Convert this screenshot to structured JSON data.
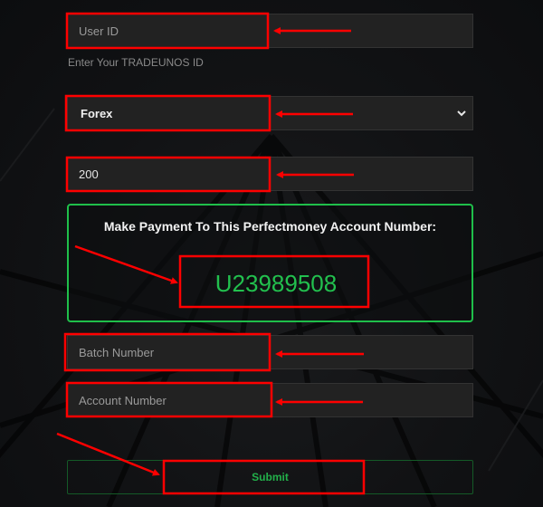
{
  "form": {
    "user_id": {
      "placeholder": "User ID",
      "help": "Enter Your TRADEUNOS ID"
    },
    "market_select": {
      "selected": "Forex",
      "icon": "chevron-down-icon"
    },
    "amount": {
      "value": "200"
    },
    "payment_panel": {
      "title": "Make Payment To This Perfectmoney Account Number:",
      "account_number": "U23989508"
    },
    "batch_number": {
      "placeholder": "Batch Number"
    },
    "account_number": {
      "placeholder": "Account Number"
    },
    "submit_label": "Submit"
  },
  "colors": {
    "accent_green": "#22c04e",
    "annotation_red": "#ff0000",
    "field_bg": "#222222"
  }
}
